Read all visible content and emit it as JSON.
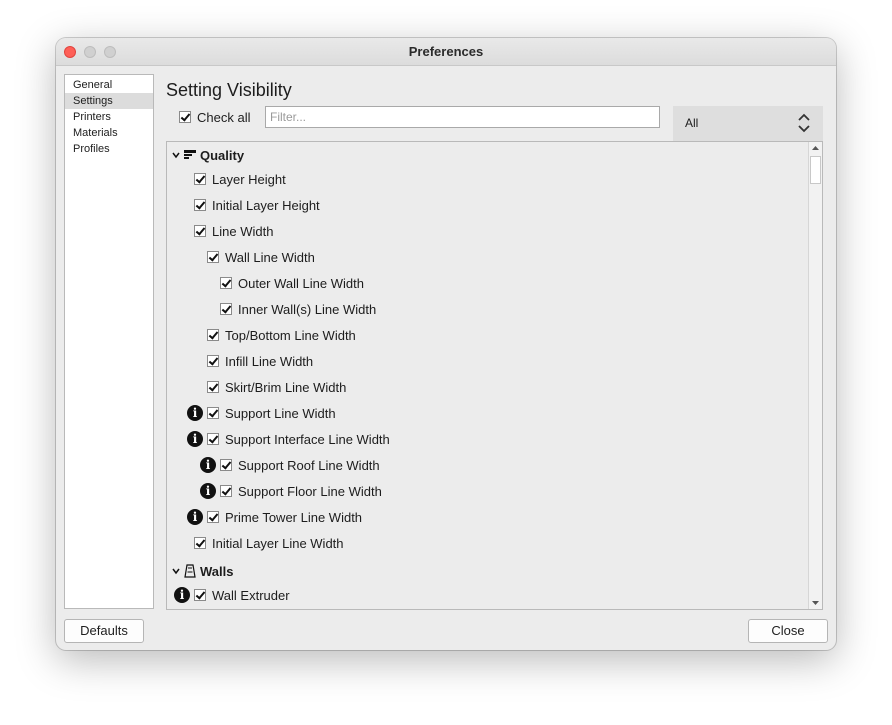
{
  "window": {
    "title": "Preferences"
  },
  "sidebar": {
    "items": [
      {
        "label": "General",
        "selected": false
      },
      {
        "label": "Settings",
        "selected": true
      },
      {
        "label": "Printers",
        "selected": false
      },
      {
        "label": "Materials",
        "selected": false
      },
      {
        "label": "Profiles",
        "selected": false
      }
    ]
  },
  "main": {
    "heading": "Setting Visibility",
    "check_all_label": "Check all",
    "check_all_checked": true,
    "filter_placeholder": "Filter...",
    "filter_value": "",
    "visibility_select": "All"
  },
  "settings": {
    "quality": {
      "label": "Quality",
      "icon": "quality-icon",
      "items": [
        {
          "label": "Layer Height",
          "checked": true,
          "info": false
        },
        {
          "label": "Initial Layer Height",
          "checked": true,
          "info": false
        },
        {
          "label": "Line Width",
          "checked": true,
          "info": false
        },
        {
          "label": "Wall Line Width",
          "checked": true,
          "info": false
        },
        {
          "label": "Outer Wall Line Width",
          "checked": true,
          "info": false
        },
        {
          "label": "Inner Wall(s) Line Width",
          "checked": true,
          "info": false
        },
        {
          "label": "Top/Bottom Line Width",
          "checked": true,
          "info": false
        },
        {
          "label": "Infill Line Width",
          "checked": true,
          "info": false
        },
        {
          "label": "Skirt/Brim Line Width",
          "checked": true,
          "info": false
        },
        {
          "label": "Support Line Width",
          "checked": true,
          "info": true
        },
        {
          "label": "Support Interface Line Width",
          "checked": true,
          "info": true
        },
        {
          "label": "Support Roof Line Width",
          "checked": true,
          "info": true
        },
        {
          "label": "Support Floor Line Width",
          "checked": true,
          "info": true
        },
        {
          "label": "Prime Tower Line Width",
          "checked": true,
          "info": true
        },
        {
          "label": "Initial Layer Line Width",
          "checked": true,
          "info": false
        }
      ]
    },
    "walls": {
      "label": "Walls",
      "icon": "walls-icon",
      "items": [
        {
          "label": "Wall Extruder",
          "checked": true,
          "info": true
        }
      ]
    },
    "info_glyph": "i"
  },
  "buttons": {
    "defaults": "Defaults",
    "close": "Close"
  },
  "colors": {
    "close_light": "#fe5f57",
    "window_bg": "#ececec",
    "select_bg": "#dedede"
  }
}
